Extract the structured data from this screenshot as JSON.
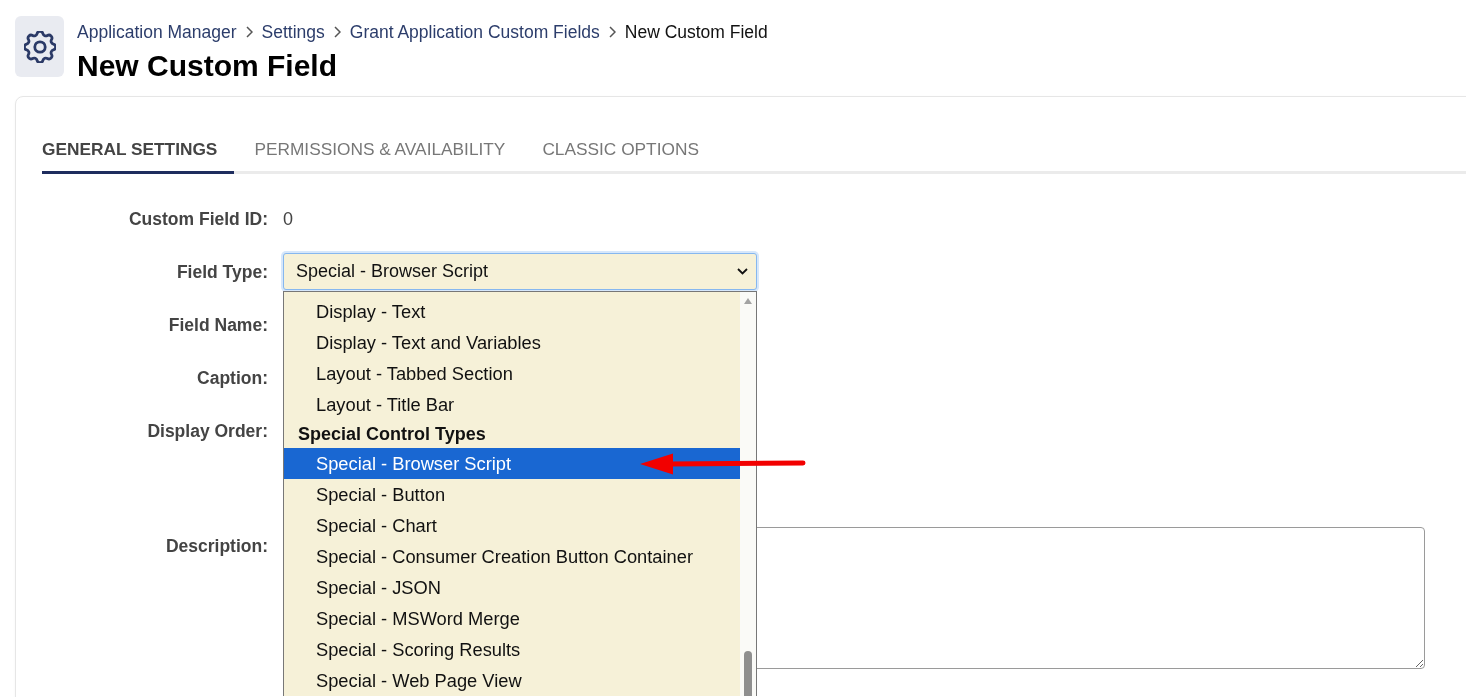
{
  "header": {
    "breadcrumb": [
      {
        "label": "Application Manager",
        "current": false
      },
      {
        "label": "Settings",
        "current": false
      },
      {
        "label": "Grant Application Custom Fields",
        "current": false
      },
      {
        "label": "New Custom Field",
        "current": true
      }
    ],
    "title": "New Custom Field"
  },
  "tabs": [
    {
      "label": "GENERAL SETTINGS",
      "selected": true
    },
    {
      "label": "PERMISSIONS & AVAILABILITY",
      "selected": false
    },
    {
      "label": "CLASSIC OPTIONS",
      "selected": false
    }
  ],
  "form": {
    "fields": [
      {
        "kind": "value",
        "label": "Custom Field ID:",
        "value": "0"
      },
      {
        "kind": "select",
        "label": "Field Type:",
        "value": "Special - Browser Script",
        "expanded": true,
        "options": [
          {
            "kind": "option",
            "label": "Display - Text",
            "selected": false
          },
          {
            "kind": "option",
            "label": "Display - Text and Variables",
            "selected": false
          },
          {
            "kind": "option",
            "label": "Layout - Tabbed Section",
            "selected": false
          },
          {
            "kind": "option",
            "label": "Layout - Title Bar",
            "selected": false
          },
          {
            "kind": "group",
            "label": "Special Control Types",
            "selected": false
          },
          {
            "kind": "option",
            "label": "Special - Browser Script",
            "selected": true
          },
          {
            "kind": "option",
            "label": "Special - Button",
            "selected": false
          },
          {
            "kind": "option",
            "label": "Special - Chart",
            "selected": false
          },
          {
            "kind": "option",
            "label": "Special - Consumer Creation Button Container",
            "selected": false
          },
          {
            "kind": "option",
            "label": "Special - JSON",
            "selected": false
          },
          {
            "kind": "option",
            "label": "Special - MSWord Merge",
            "selected": false
          },
          {
            "kind": "option",
            "label": "Special - Scoring Results",
            "selected": false
          },
          {
            "kind": "option",
            "label": "Special - Web Page View",
            "selected": false
          }
        ]
      },
      {
        "kind": "covered",
        "label": "Field Name:"
      },
      {
        "kind": "covered",
        "label": "Caption:"
      },
      {
        "kind": "covered",
        "label": "Display Order:"
      },
      {
        "kind": "textarea",
        "label": "Description:"
      }
    ]
  }
}
